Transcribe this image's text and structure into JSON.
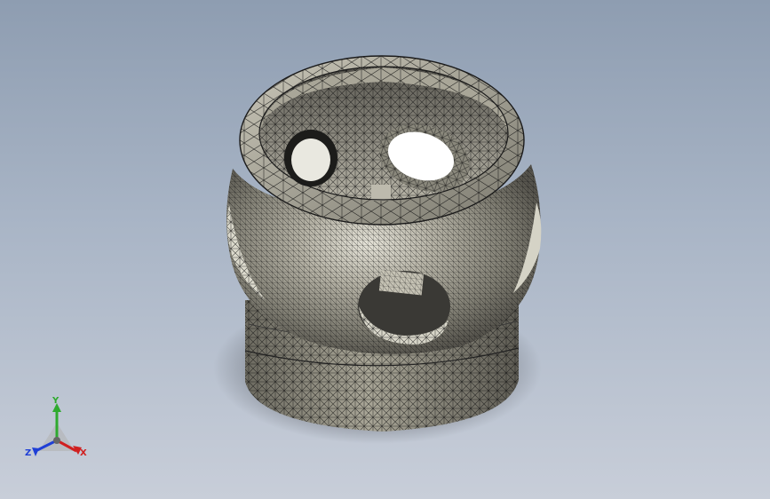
{
  "triad": {
    "x_label": "X",
    "y_label": "Y",
    "z_label": "Z",
    "colors": {
      "x": "#d02020",
      "y": "#2faa2f",
      "z": "#1f3fd6"
    }
  },
  "colors": {
    "background_top": "#8e9db1",
    "background_bottom": "#c8ced9",
    "surface": "#8f8c80",
    "mesh": "#101010"
  },
  "icons": [
    "coordinate-triad-icon"
  ]
}
